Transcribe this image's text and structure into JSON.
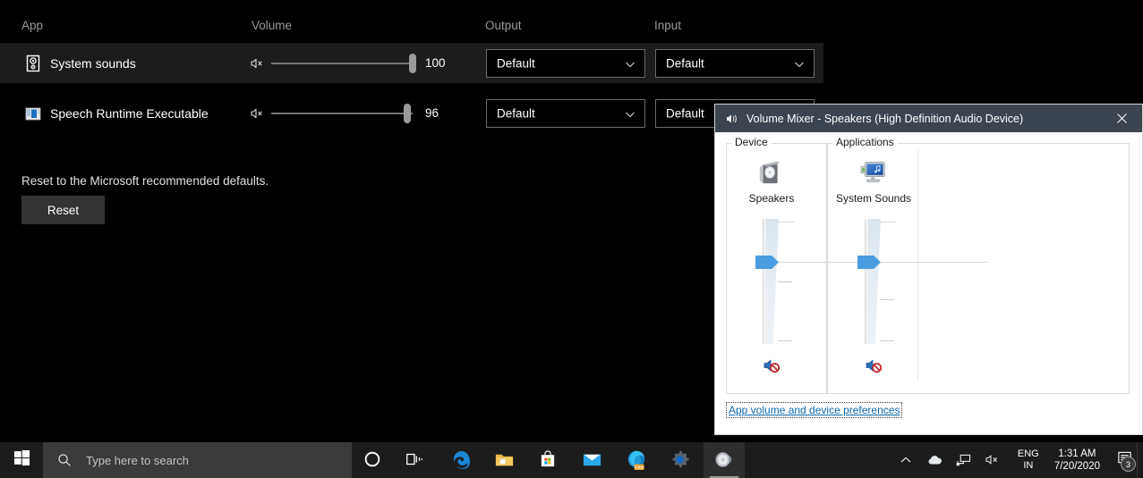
{
  "settings": {
    "columns": {
      "app": "App",
      "volume": "Volume",
      "output": "Output",
      "input": "Input"
    },
    "rows": [
      {
        "icon": "speaker-box-icon",
        "name": "System sounds",
        "volume": 100,
        "volume_label": "100",
        "muted": true,
        "output": "Default",
        "input": "Default",
        "selected": true
      },
      {
        "icon": "speech-runtime-icon",
        "name": "Speech Runtime Executable",
        "volume": 96,
        "volume_label": "96",
        "muted": true,
        "output": "Default",
        "input": "Default",
        "selected": false
      }
    ],
    "reset_description": "Reset to the Microsoft recommended defaults.",
    "reset_button": "Reset"
  },
  "volume_mixer": {
    "title": "Volume Mixer - Speakers (High Definition Audio Device)",
    "title_icon": "speaker-icon",
    "close_icon": "close-icon",
    "groups": {
      "device": "Device",
      "applications": "Applications"
    },
    "device_strip": {
      "icon": "speakers-icon",
      "name": "Speakers",
      "volume_percent": 72,
      "muted": true,
      "mute_icon": "speaker-muted-icon"
    },
    "application_strips": [
      {
        "icon": "system-sounds-icon",
        "name": "System Sounds",
        "volume_percent": 72,
        "muted": true,
        "mute_icon": "speaker-muted-icon"
      }
    ],
    "link": "App volume and device preferences"
  },
  "taskbar": {
    "start_icon": "windows-logo-icon",
    "search": {
      "icon": "search-icon",
      "placeholder": "Type here to search"
    },
    "buttons": [
      {
        "name": "cortana-button",
        "icon": "cortana-circle-icon",
        "active": false
      },
      {
        "name": "task-view-button",
        "icon": "task-view-icon",
        "active": false
      },
      {
        "name": "internet-explorer-button",
        "icon": "edge-legacy-icon",
        "active": false
      },
      {
        "name": "file-explorer-button",
        "icon": "folder-icon",
        "active": false
      },
      {
        "name": "microsoft-store-button",
        "icon": "store-bag-icon",
        "active": false
      },
      {
        "name": "mail-button",
        "icon": "mail-envelope-icon",
        "active": false
      },
      {
        "name": "edge-canary-button",
        "icon": "edge-canary-icon",
        "active": false
      },
      {
        "name": "settings-button",
        "icon": "gear-icon",
        "active": false
      },
      {
        "name": "volume-mixer-button",
        "icon": "speaker-grey-icon",
        "active": true
      }
    ],
    "tray": {
      "chevron": "chevron-up-icon",
      "onedrive": "cloud-icon",
      "network": "network-icon",
      "volume": "speaker-muted-icon",
      "language_top": "ENG",
      "language_bottom": "IN",
      "time": "1:31 AM",
      "date": "7/20/2020",
      "notifications_icon": "notification-icon",
      "notifications_count": "3"
    }
  },
  "colors": {
    "accent_blue": "#4a9de0",
    "titlebar": "#3c4450",
    "link": "#0c67b0",
    "taskbar": "#1c1c1c",
    "selected_row": "#1c1c1c"
  }
}
